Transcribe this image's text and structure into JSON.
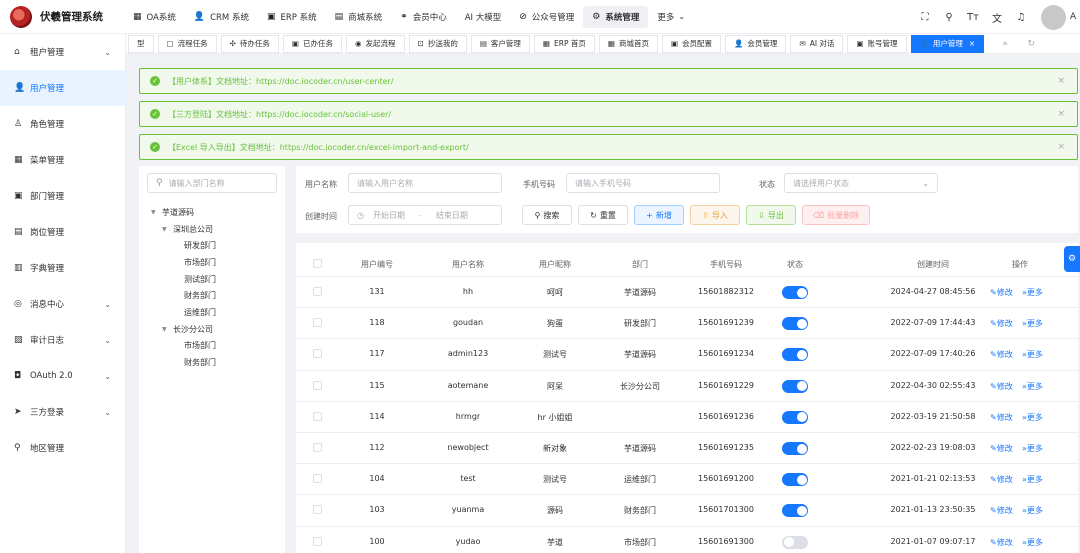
{
  "app": {
    "title": "伏羲管理系统",
    "user": "A"
  },
  "topnav": [
    {
      "icon": "▦",
      "label": "OA系统",
      "active": false
    },
    {
      "icon": "👤",
      "label": "CRM 系统",
      "active": false
    },
    {
      "icon": "▣",
      "label": "ERP 系统",
      "active": false
    },
    {
      "icon": "▤",
      "label": "商城系统",
      "active": false
    },
    {
      "icon": "⚭",
      "label": "会员中心",
      "active": false
    },
    {
      "icon": "",
      "label": "AI 大模型",
      "active": false
    },
    {
      "icon": "⊘",
      "label": "公众号管理",
      "active": false
    },
    {
      "icon": "⚙",
      "label": "系统管理",
      "active": true
    },
    {
      "icon": "",
      "label": "更多",
      "active": false
    }
  ],
  "sidebar": [
    {
      "icon": "⌂",
      "label": "租户管理",
      "expandable": true,
      "active": false
    },
    {
      "icon": "👤",
      "label": "用户管理",
      "expandable": false,
      "active": true
    },
    {
      "icon": "♙",
      "label": "角色管理",
      "expandable": false,
      "active": false
    },
    {
      "icon": "▦",
      "label": "菜单管理",
      "expandable": false,
      "active": false
    },
    {
      "icon": "▣",
      "label": "部门管理",
      "expandable": false,
      "active": false
    },
    {
      "icon": "▤",
      "label": "岗位管理",
      "expandable": false,
      "active": false
    },
    {
      "icon": "▥",
      "label": "字典管理",
      "expandable": false,
      "active": false
    },
    {
      "icon": "◎",
      "label": "消息中心",
      "expandable": true,
      "active": false
    },
    {
      "icon": "▧",
      "label": "审计日志",
      "expandable": true,
      "active": false
    },
    {
      "icon": "◘",
      "label": "OAuth 2.0",
      "expandable": true,
      "active": false
    },
    {
      "icon": "➤",
      "label": "三方登录",
      "expandable": true,
      "active": false
    },
    {
      "icon": "⚲",
      "label": "地区管理",
      "expandable": false,
      "active": false
    }
  ],
  "tabs": [
    {
      "label": "型",
      "icon": "",
      "active": false
    },
    {
      "label": "流程任务",
      "icon": "▢",
      "active": false
    },
    {
      "label": "待办任务",
      "icon": "✣",
      "active": false
    },
    {
      "label": "已办任务",
      "icon": "▣",
      "active": false
    },
    {
      "label": "发起流程",
      "icon": "◉",
      "active": false
    },
    {
      "label": "抄送我的",
      "icon": "⊡",
      "active": false
    },
    {
      "label": "客户管理",
      "icon": "▤",
      "active": false
    },
    {
      "label": "ERP 首页",
      "icon": "▦",
      "active": false
    },
    {
      "label": "商城首页",
      "icon": "▦",
      "active": false
    },
    {
      "label": "会员配置",
      "icon": "▣",
      "active": false
    },
    {
      "label": "会员管理",
      "icon": "👤",
      "active": false
    },
    {
      "label": "AI 对话",
      "icon": "✉",
      "active": false
    },
    {
      "label": "账号管理",
      "icon": "▣",
      "active": false
    },
    {
      "label": "用户管理",
      "icon": "👤",
      "active": true,
      "close": "×"
    }
  ],
  "tab_nav": {
    "next": "»",
    "refresh": "↻"
  },
  "alerts": [
    {
      "text": "【用户体系】文档地址：https://doc.iocoder.cn/user-center/"
    },
    {
      "text": "【三方登陆】文档地址：https://doc.iocoder.cn/social-user/"
    },
    {
      "text": "【Excel 导入导出】文档地址：https://doc.iocoder.cn/excel-import-and-export/"
    }
  ],
  "dept_search": {
    "placeholder": "请输入部门名称"
  },
  "dept_tree": [
    {
      "label": "芋道源码",
      "level": 0,
      "toggle": "▼"
    },
    {
      "label": "深圳总公司",
      "level": 1,
      "toggle": "▼"
    },
    {
      "label": "研发部门",
      "level": 2,
      "toggle": ""
    },
    {
      "label": "市场部门",
      "level": 2,
      "toggle": ""
    },
    {
      "label": "测试部门",
      "level": 2,
      "toggle": ""
    },
    {
      "label": "财务部门",
      "level": 2,
      "toggle": ""
    },
    {
      "label": "运维部门",
      "level": 2,
      "toggle": ""
    },
    {
      "label": "长沙分公司",
      "level": 1,
      "toggle": "▼"
    },
    {
      "label": "市场部门",
      "level": 2,
      "toggle": ""
    },
    {
      "label": "财务部门",
      "level": 2,
      "toggle": ""
    }
  ],
  "search_form": {
    "username_label": "用户名称",
    "username_placeholder": "请输入用户名称",
    "mobile_label": "手机号码",
    "mobile_placeholder": "请输入手机号码",
    "status_label": "状态",
    "status_placeholder": "请选择用户状态",
    "created_label": "创建时间",
    "start_placeholder": "开始日期",
    "range_sep": "-",
    "end_placeholder": "结束日期",
    "search_btn": "搜索",
    "reset_btn": "重置",
    "add_btn": "新增",
    "import_btn": "导入",
    "export_btn": "导出",
    "batch_delete_btn": "批量删除"
  },
  "table": {
    "headers": [
      "用户编号",
      "用户名称",
      "用户昵称",
      "部门",
      "手机号码",
      "状态",
      "创建时间",
      "操作"
    ],
    "edit_label": "修改",
    "more_label": "更多",
    "rows": [
      {
        "id": "131",
        "username": "hh",
        "nickname": "呵呵",
        "dept": "芋道源码",
        "mobile": "15601882312",
        "status": true,
        "created": "2024-04-27 08:45:56"
      },
      {
        "id": "118",
        "username": "goudan",
        "nickname": "狗蛋",
        "dept": "研发部门",
        "mobile": "15601691239",
        "status": true,
        "created": "2022-07-09 17:44:43"
      },
      {
        "id": "117",
        "username": "admin123",
        "nickname": "测试号",
        "dept": "芋道源码",
        "mobile": "15601691234",
        "status": true,
        "created": "2022-07-09 17:40:26"
      },
      {
        "id": "115",
        "username": "aotemane",
        "nickname": "阿呆",
        "dept": "长沙分公司",
        "mobile": "15601691229",
        "status": true,
        "created": "2022-04-30 02:55:43"
      },
      {
        "id": "114",
        "username": "hrmgr",
        "nickname": "hr 小姐姐",
        "dept": "",
        "mobile": "15601691236",
        "status": true,
        "created": "2022-03-19 21:50:58"
      },
      {
        "id": "112",
        "username": "newobject",
        "nickname": "新对象",
        "dept": "芋道源码",
        "mobile": "15601691235",
        "status": true,
        "created": "2022-02-23 19:08:03"
      },
      {
        "id": "104",
        "username": "test",
        "nickname": "测试号",
        "dept": "运维部门",
        "mobile": "15601691200",
        "status": true,
        "created": "2021-01-21 02:13:53"
      },
      {
        "id": "103",
        "username": "yuanma",
        "nickname": "源码",
        "dept": "财务部门",
        "mobile": "15601701300",
        "status": true,
        "created": "2021-01-13 23:50:35"
      },
      {
        "id": "100",
        "username": "yudao",
        "nickname": "芋道",
        "dept": "市场部门",
        "mobile": "15601691300",
        "status": false,
        "created": "2021-01-07 09:07:17"
      }
    ]
  },
  "colors": {
    "primary": "#1677ff",
    "success": "#67c23a",
    "warning": "#e6a23c",
    "danger": "#f56c6c"
  }
}
